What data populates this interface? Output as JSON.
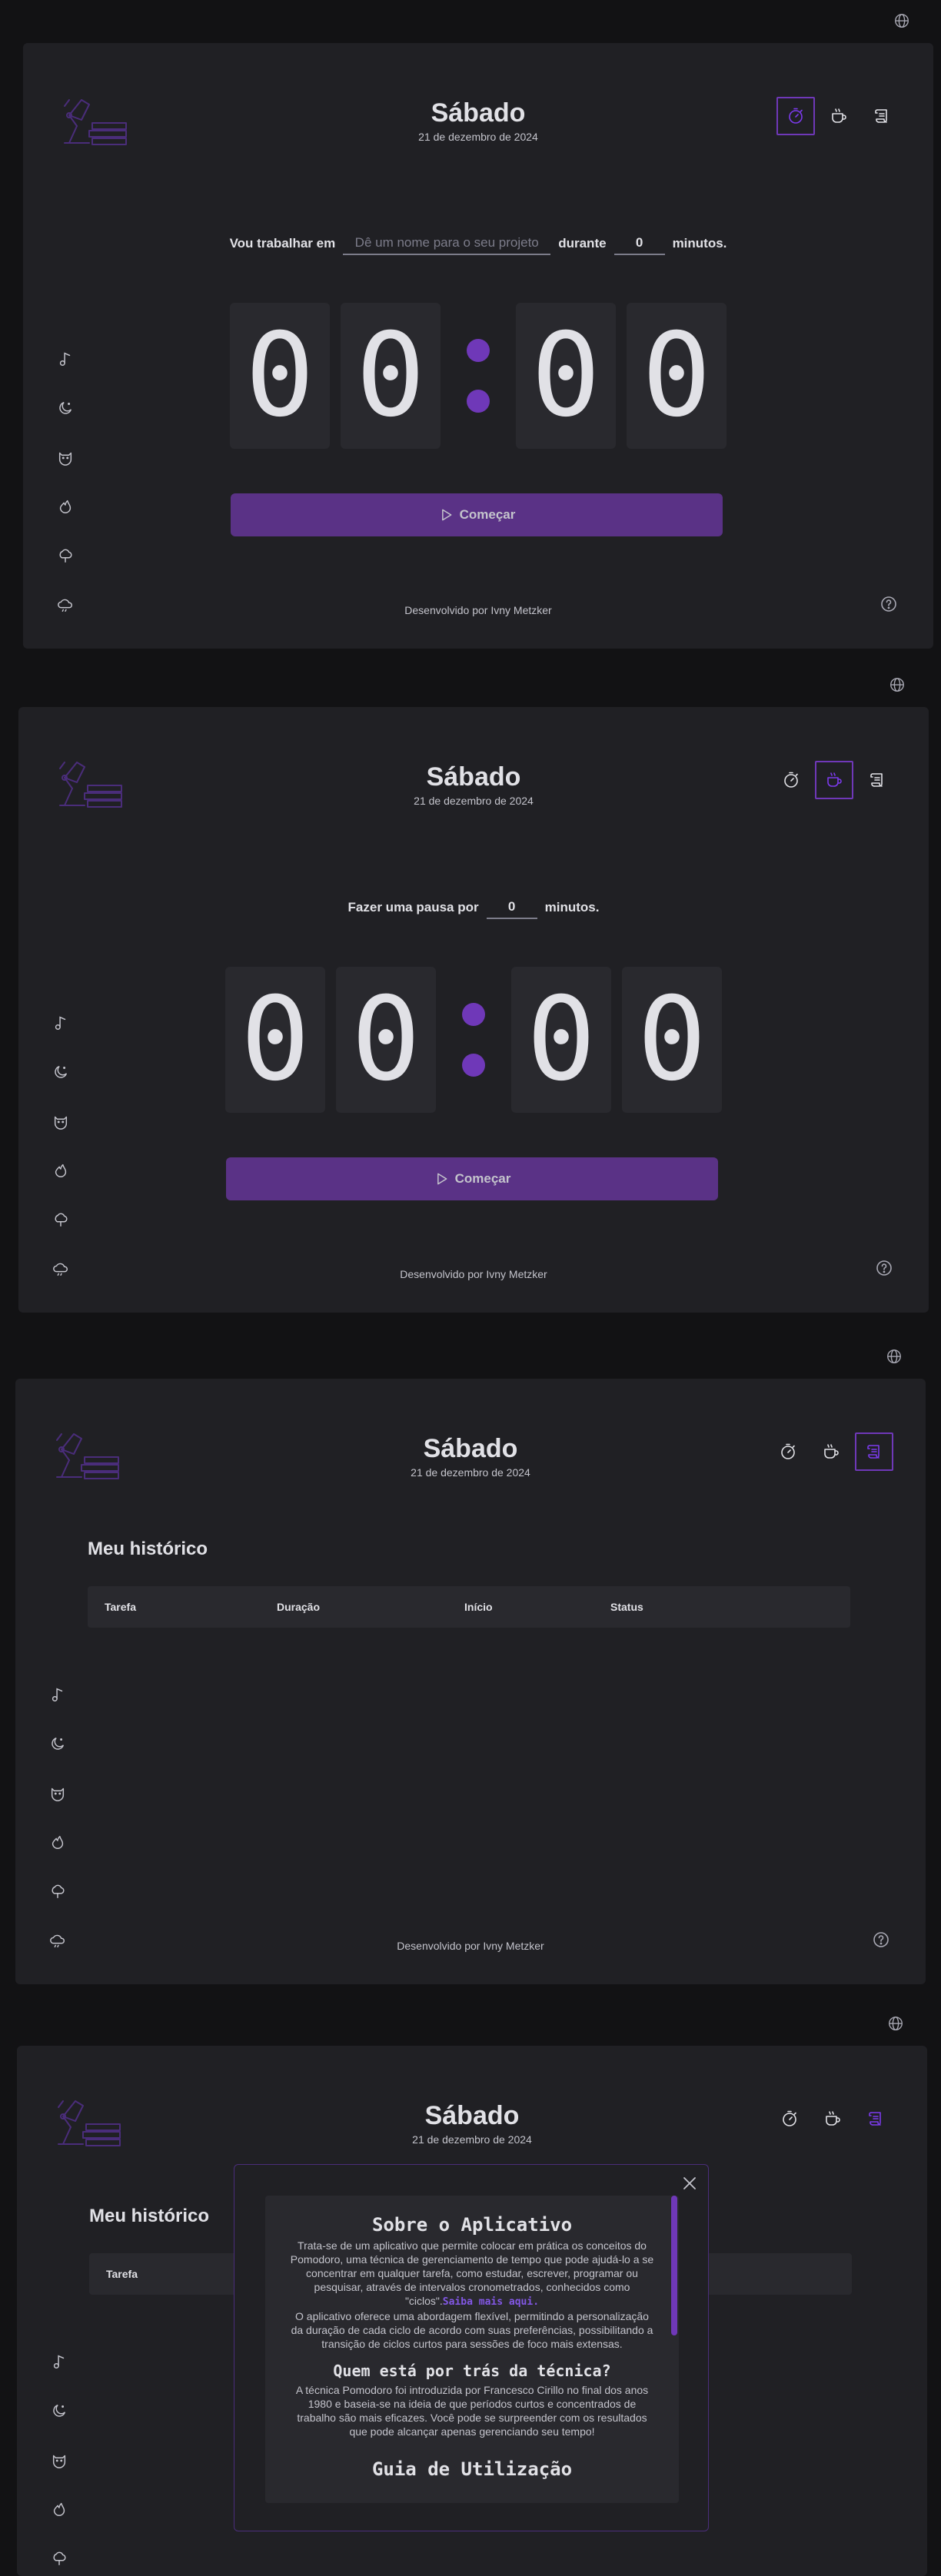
{
  "header": {
    "day": "Sábado",
    "date": "21 de dezembro de 2024"
  },
  "nav": {
    "timer_icon": "stopwatch-icon",
    "break_icon": "coffee-icon",
    "history_icon": "scroll-icon"
  },
  "sidebar_icons": [
    "music-note-icon",
    "moon-icon",
    "cat-icon",
    "flame-icon",
    "tree-icon",
    "cloud-rain-icon"
  ],
  "work": {
    "prefix": "Vou trabalhar em",
    "project_placeholder": "Dê um nome para o seu projeto",
    "during": "durante",
    "minutes_value": "0",
    "suffix": "minutos."
  },
  "break": {
    "prefix": "Fazer uma pausa por",
    "minutes_value": "0",
    "suffix": "minutos."
  },
  "timer": {
    "digits": [
      "0",
      "0",
      "0",
      "0"
    ]
  },
  "start_label": "Começar",
  "footer": "Desenvolvido por Ivny Metzker",
  "history": {
    "title": "Meu histórico",
    "columns": [
      "Tarefa",
      "Duração",
      "Início",
      "Status"
    ]
  },
  "modal": {
    "about_title": "Sobre o Aplicativo",
    "about_p1": "Trata-se de um aplicativo que permite colocar em prática os conceitos do Pomodoro, uma técnica de gerenciamento de tempo que pode ajudá-lo a se concentrar em qualquer tarefa, como estudar, escrever, programar ou pesquisar, através de intervalos cronometrados, conhecidos como \"ciclos\".",
    "about_link": "Saiba mais aqui.",
    "about_p2": "O aplicativo oferece uma abordagem flexível, permitindo a personalização da duração de cada ciclo de acordo com suas preferências, possibilitando a transição de ciclos curtos para sessões de foco mais extensas.",
    "technique_title": "Quem está por trás da técnica?",
    "technique_p": "A técnica Pomodoro foi introduzida por Francesco Cirillo no final dos anos 1980 e baseia-se na ideia de que períodos curtos e concentrados de trabalho são mais eficazes. Você pode se surpreender com os resultados que pode alcançar apenas gerenciando seu tempo!",
    "guide_title": "Guia de Utilização"
  },
  "colors": {
    "accent": "#6f38b8",
    "button": "#5a3286",
    "panel": "#202024",
    "background": "#121214"
  }
}
